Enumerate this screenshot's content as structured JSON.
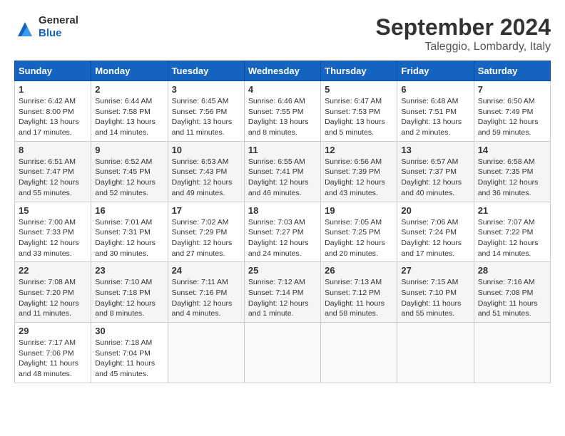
{
  "header": {
    "logo_general": "General",
    "logo_blue": "Blue",
    "month_title": "September 2024",
    "location": "Taleggio, Lombardy, Italy"
  },
  "columns": [
    "Sunday",
    "Monday",
    "Tuesday",
    "Wednesday",
    "Thursday",
    "Friday",
    "Saturday"
  ],
  "weeks": [
    [
      {
        "day": "1",
        "sunrise": "Sunrise: 6:42 AM",
        "sunset": "Sunset: 8:00 PM",
        "daylight": "Daylight: 13 hours and 17 minutes."
      },
      {
        "day": "2",
        "sunrise": "Sunrise: 6:44 AM",
        "sunset": "Sunset: 7:58 PM",
        "daylight": "Daylight: 13 hours and 14 minutes."
      },
      {
        "day": "3",
        "sunrise": "Sunrise: 6:45 AM",
        "sunset": "Sunset: 7:56 PM",
        "daylight": "Daylight: 13 hours and 11 minutes."
      },
      {
        "day": "4",
        "sunrise": "Sunrise: 6:46 AM",
        "sunset": "Sunset: 7:55 PM",
        "daylight": "Daylight: 13 hours and 8 minutes."
      },
      {
        "day": "5",
        "sunrise": "Sunrise: 6:47 AM",
        "sunset": "Sunset: 7:53 PM",
        "daylight": "Daylight: 13 hours and 5 minutes."
      },
      {
        "day": "6",
        "sunrise": "Sunrise: 6:48 AM",
        "sunset": "Sunset: 7:51 PM",
        "daylight": "Daylight: 13 hours and 2 minutes."
      },
      {
        "day": "7",
        "sunrise": "Sunrise: 6:50 AM",
        "sunset": "Sunset: 7:49 PM",
        "daylight": "Daylight: 12 hours and 59 minutes."
      }
    ],
    [
      {
        "day": "8",
        "sunrise": "Sunrise: 6:51 AM",
        "sunset": "Sunset: 7:47 PM",
        "daylight": "Daylight: 12 hours and 55 minutes."
      },
      {
        "day": "9",
        "sunrise": "Sunrise: 6:52 AM",
        "sunset": "Sunset: 7:45 PM",
        "daylight": "Daylight: 12 hours and 52 minutes."
      },
      {
        "day": "10",
        "sunrise": "Sunrise: 6:53 AM",
        "sunset": "Sunset: 7:43 PM",
        "daylight": "Daylight: 12 hours and 49 minutes."
      },
      {
        "day": "11",
        "sunrise": "Sunrise: 6:55 AM",
        "sunset": "Sunset: 7:41 PM",
        "daylight": "Daylight: 12 hours and 46 minutes."
      },
      {
        "day": "12",
        "sunrise": "Sunrise: 6:56 AM",
        "sunset": "Sunset: 7:39 PM",
        "daylight": "Daylight: 12 hours and 43 minutes."
      },
      {
        "day": "13",
        "sunrise": "Sunrise: 6:57 AM",
        "sunset": "Sunset: 7:37 PM",
        "daylight": "Daylight: 12 hours and 40 minutes."
      },
      {
        "day": "14",
        "sunrise": "Sunrise: 6:58 AM",
        "sunset": "Sunset: 7:35 PM",
        "daylight": "Daylight: 12 hours and 36 minutes."
      }
    ],
    [
      {
        "day": "15",
        "sunrise": "Sunrise: 7:00 AM",
        "sunset": "Sunset: 7:33 PM",
        "daylight": "Daylight: 12 hours and 33 minutes."
      },
      {
        "day": "16",
        "sunrise": "Sunrise: 7:01 AM",
        "sunset": "Sunset: 7:31 PM",
        "daylight": "Daylight: 12 hours and 30 minutes."
      },
      {
        "day": "17",
        "sunrise": "Sunrise: 7:02 AM",
        "sunset": "Sunset: 7:29 PM",
        "daylight": "Daylight: 12 hours and 27 minutes."
      },
      {
        "day": "18",
        "sunrise": "Sunrise: 7:03 AM",
        "sunset": "Sunset: 7:27 PM",
        "daylight": "Daylight: 12 hours and 24 minutes."
      },
      {
        "day": "19",
        "sunrise": "Sunrise: 7:05 AM",
        "sunset": "Sunset: 7:25 PM",
        "daylight": "Daylight: 12 hours and 20 minutes."
      },
      {
        "day": "20",
        "sunrise": "Sunrise: 7:06 AM",
        "sunset": "Sunset: 7:24 PM",
        "daylight": "Daylight: 12 hours and 17 minutes."
      },
      {
        "day": "21",
        "sunrise": "Sunrise: 7:07 AM",
        "sunset": "Sunset: 7:22 PM",
        "daylight": "Daylight: 12 hours and 14 minutes."
      }
    ],
    [
      {
        "day": "22",
        "sunrise": "Sunrise: 7:08 AM",
        "sunset": "Sunset: 7:20 PM",
        "daylight": "Daylight: 12 hours and 11 minutes."
      },
      {
        "day": "23",
        "sunrise": "Sunrise: 7:10 AM",
        "sunset": "Sunset: 7:18 PM",
        "daylight": "Daylight: 12 hours and 8 minutes."
      },
      {
        "day": "24",
        "sunrise": "Sunrise: 7:11 AM",
        "sunset": "Sunset: 7:16 PM",
        "daylight": "Daylight: 12 hours and 4 minutes."
      },
      {
        "day": "25",
        "sunrise": "Sunrise: 7:12 AM",
        "sunset": "Sunset: 7:14 PM",
        "daylight": "Daylight: 12 hours and 1 minute."
      },
      {
        "day": "26",
        "sunrise": "Sunrise: 7:13 AM",
        "sunset": "Sunset: 7:12 PM",
        "daylight": "Daylight: 11 hours and 58 minutes."
      },
      {
        "day": "27",
        "sunrise": "Sunrise: 7:15 AM",
        "sunset": "Sunset: 7:10 PM",
        "daylight": "Daylight: 11 hours and 55 minutes."
      },
      {
        "day": "28",
        "sunrise": "Sunrise: 7:16 AM",
        "sunset": "Sunset: 7:08 PM",
        "daylight": "Daylight: 11 hours and 51 minutes."
      }
    ],
    [
      {
        "day": "29",
        "sunrise": "Sunrise: 7:17 AM",
        "sunset": "Sunset: 7:06 PM",
        "daylight": "Daylight: 11 hours and 48 minutes."
      },
      {
        "day": "30",
        "sunrise": "Sunrise: 7:18 AM",
        "sunset": "Sunset: 7:04 PM",
        "daylight": "Daylight: 11 hours and 45 minutes."
      },
      null,
      null,
      null,
      null,
      null
    ]
  ]
}
